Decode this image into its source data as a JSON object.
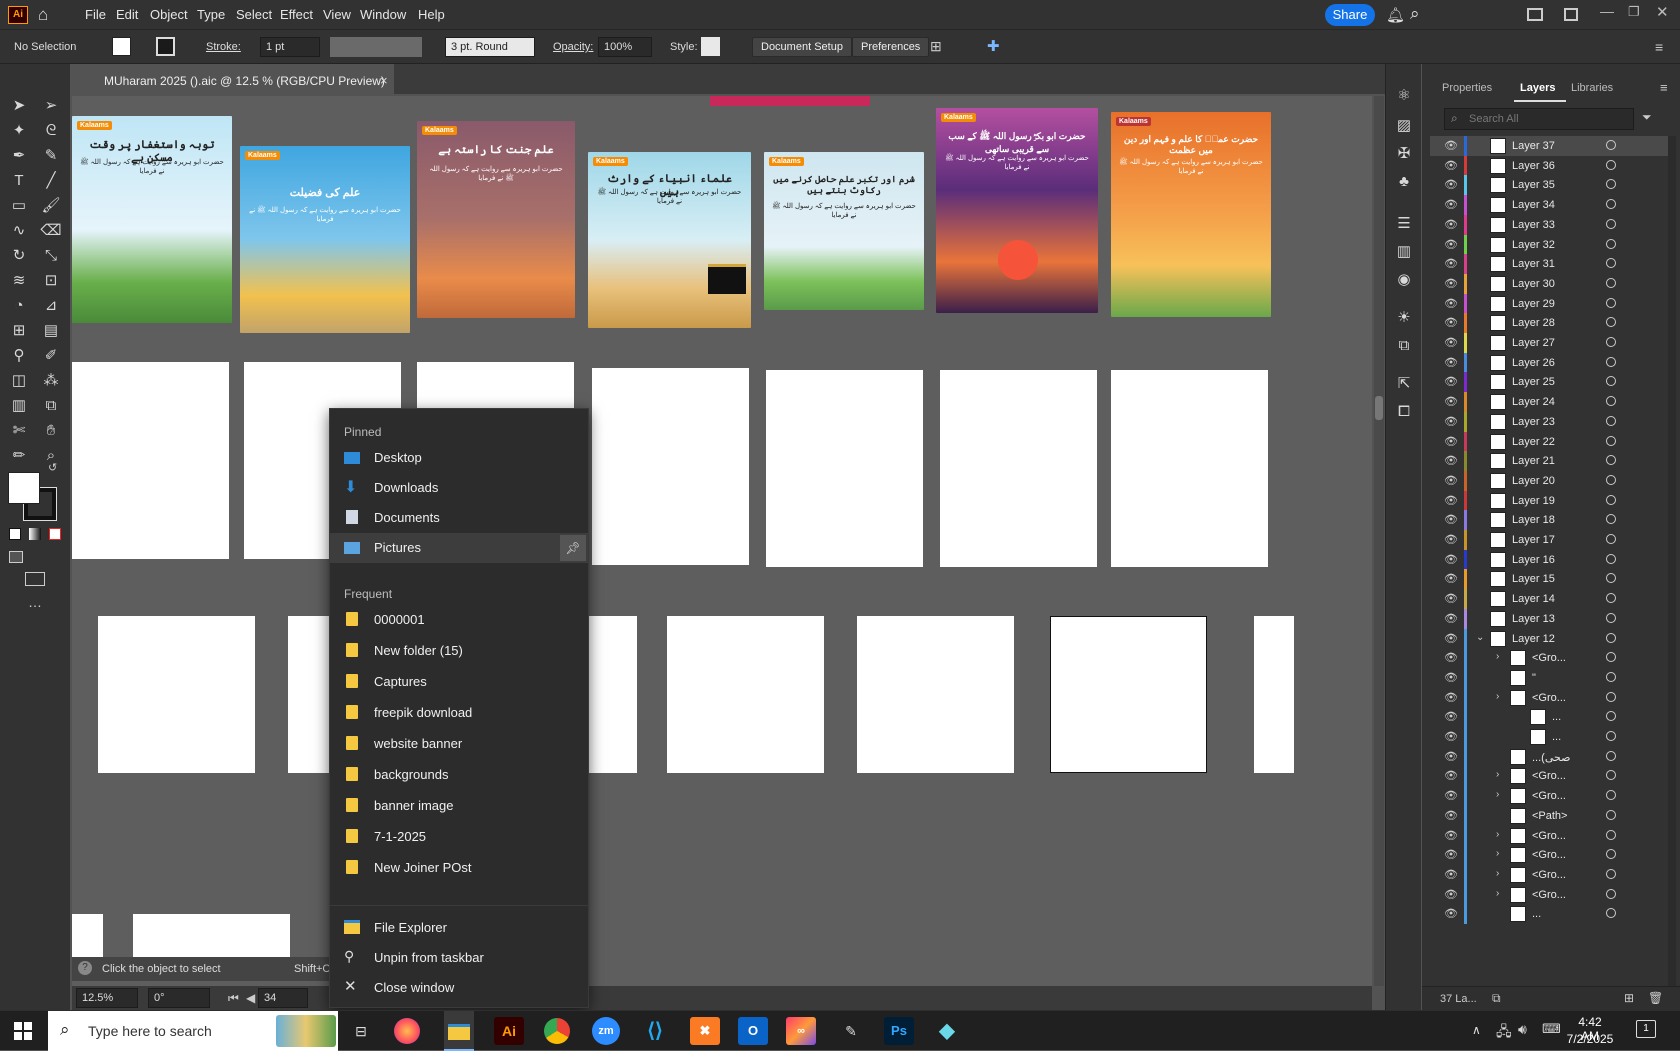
{
  "menubar": {
    "app_icon": "Ai",
    "items": [
      "File",
      "Edit",
      "Object",
      "Type",
      "Select",
      "Effect",
      "View",
      "Window",
      "Help"
    ],
    "share_label": "Share"
  },
  "control_bar": {
    "selection": "No Selection",
    "stroke_label": "Stroke:",
    "stroke_value": "1 pt",
    "brush_value": "3 pt. Round",
    "opacity_label": "Opacity:",
    "opacity_value": "100%",
    "style_label": "Style:",
    "document_setup": "Document Setup",
    "preferences": "Preferences"
  },
  "document_tab": {
    "title": "MUharam 2025 ().aic @ 12.5 % (RGB/CPU Preview)",
    "close": "×"
  },
  "posters": [
    {
      "title": "توبہ واستغفار پر وقت مسکن ہے",
      "bg": "#bfe6f5",
      "accent": "#2e7d32"
    },
    {
      "title": "علم کی فضیلت",
      "bg": "#3fa6e0",
      "accent": "#f2c14e"
    },
    {
      "title": "علم جنت کا راستہ ہے",
      "bg": "#8a5a6b",
      "accent": "#e98b4a"
    },
    {
      "title": "علماء انبیاء کے وارث ہیں",
      "bg": "#9fd7e8",
      "accent": "#e0a050"
    },
    {
      "title": "شرم اور تکبر علم حاصل کرنے میں رکاوٹ بنتے ہیں",
      "bg": "#cfe6f0",
      "accent": "#5a9b4a"
    },
    {
      "title": "حضرت ابو بکرؓ رسول اللہ ﷺ کے سب سے قریبی ساتھی",
      "bg": "#5a2d7a",
      "accent": "#e8743a"
    },
    {
      "title": "حضرت عمرؓ کا علم و فہم اور دین میں عظمت",
      "bg": "#e8702a",
      "accent": "#f7c15a"
    }
  ],
  "poster_body": "حضرت ابو ہریرہ سے روایت ہے کہ رسول اللہ ﷺ نے فرمایا",
  "logo_text": "Kalaams",
  "panel": {
    "tabs": [
      "Properties",
      "Layers",
      "Libraries"
    ],
    "search_placeholder": "Search All",
    "layers": [
      "Layer 37",
      "Layer 36",
      "Layer 35",
      "Layer 34",
      "Layer 33",
      "Layer 32",
      "Layer 31",
      "Layer 30",
      "Layer 29",
      "Layer 28",
      "Layer 27",
      "Layer 26",
      "Layer 25",
      "Layer 24",
      "Layer 23",
      "Layer 22",
      "Layer 21",
      "Layer 20",
      "Layer 19",
      "Layer 18",
      "Layer 17",
      "Layer 16",
      "Layer 15",
      "Layer 14",
      "Layer 13",
      "Layer 12"
    ],
    "layer_colors": [
      "#2a6ad8",
      "#d63b3b",
      "#57c7e8",
      "#c84fd0",
      "#e03a8b",
      "#6fd04a",
      "#d93f8a",
      "#e8a23a",
      "#c84fd0",
      "#e87a2a",
      "#e0d84a",
      "#4a8be0",
      "#7a2ad0",
      "#d88a2a",
      "#a8a82a",
      "#c83a5a",
      "#8a8a2a",
      "#c8642a",
      "#c83a3a",
      "#8a7ae0",
      "#c8942a",
      "#2a3ac8",
      "#e89a2a",
      "#c8a84a",
      "#a88ae0",
      "#4a9ae0"
    ],
    "sublayers": [
      "<Gro...",
      "\"",
      "<Gro...",
      "...",
      "...",
      "...(صحی",
      "<Gro...",
      "<Gro...",
      "<Path>",
      "<Gro...",
      "<Gro...",
      "<Gro...",
      "<Gro...",
      "..."
    ],
    "footer": "37 La..."
  },
  "context_menu": {
    "pinned_header": "Pinned",
    "pinned": [
      "Desktop",
      "Downloads",
      "Documents",
      "Pictures"
    ],
    "frequent_header": "Frequent",
    "frequent": [
      "0000001",
      "New folder (15)",
      "Captures",
      "freepik download",
      "website banner",
      "backgrounds",
      "banner image",
      "7-1-2025",
      "New Joiner POst"
    ],
    "actions": [
      "File Explorer",
      "Unpin from taskbar",
      "Close window"
    ]
  },
  "status": {
    "zoom": "12.5%",
    "rotation": "0°",
    "page": "34",
    "hint": "Click the object to select",
    "hint2": "Shift+Click to select"
  },
  "taskbar": {
    "search_placeholder": "Type here to search",
    "time": "4:42 AM",
    "date": "7/2/2025",
    "notification_count": "1"
  }
}
